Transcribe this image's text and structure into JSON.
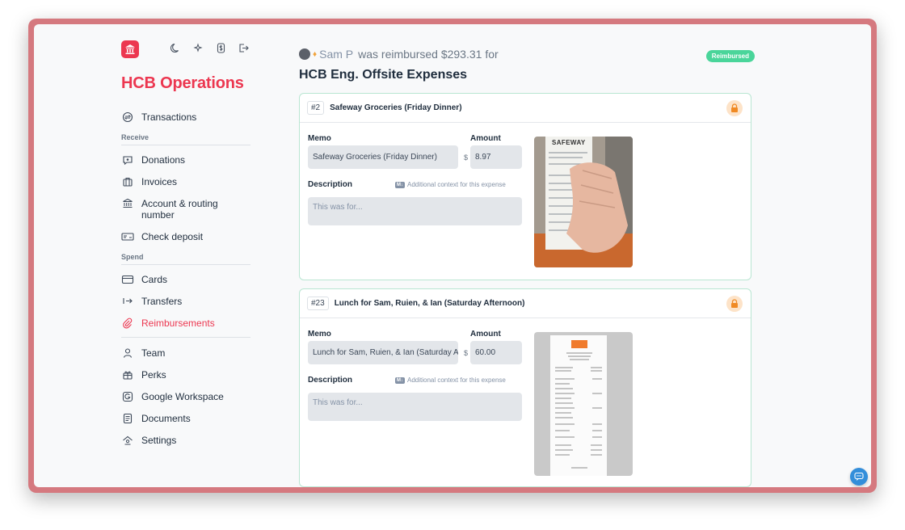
{
  "org": {
    "name": "HCB Operations"
  },
  "nav": {
    "transactions": "Transactions",
    "receive_label": "Receive",
    "donations": "Donations",
    "invoices": "Invoices",
    "account_routing": "Account & routing number",
    "check_deposit": "Check deposit",
    "spend_label": "Spend",
    "cards": "Cards",
    "transfers": "Transfers",
    "reimbursements": "Reimbursements",
    "team": "Team",
    "perks": "Perks",
    "google_workspace": "Google Workspace",
    "documents": "Documents",
    "settings": "Settings"
  },
  "report": {
    "user_name": "Sam P",
    "header_text": "was reimbursed $293.31 for",
    "status": "Reimbursed",
    "title": "HCB Eng. Offsite Expenses"
  },
  "labels": {
    "memo": "Memo",
    "amount": "Amount",
    "description": "Description",
    "md_hint": "Additional context for this expense",
    "md_badge": "M↓",
    "currency": "$"
  },
  "expenses": [
    {
      "number": "#2",
      "title": "Safeway Groceries (Friday Dinner)",
      "memo": "Safeway Groceries (Friday Dinner)",
      "amount": "8.97",
      "description_placeholder": "This was for...",
      "receipt_brand": "SAFEWAY"
    },
    {
      "number": "#23",
      "title": "Lunch for Sam, Ruien, & Ian (Saturday Afternoon)",
      "memo": "Lunch for Sam, Ruien, & Ian (Saturday Afternoon)",
      "amount": "60.00",
      "description_placeholder": "This was for..."
    }
  ],
  "colors": {
    "brand": "#ec3750",
    "success": "#4ad59a",
    "lock_bg": "#fde3c8",
    "lock": "#f08a24"
  }
}
